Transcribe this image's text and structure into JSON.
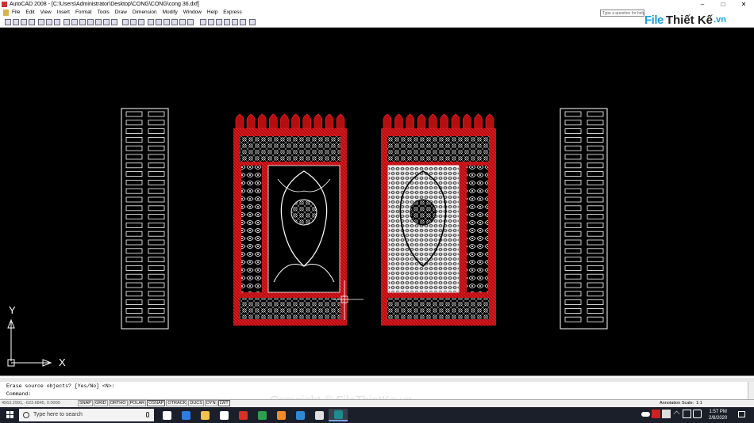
{
  "window": {
    "title": "AutoCAD 2008 - [C:\\Users\\Administrator\\Desktop\\CONG\\CONG\\cong 36.dxf]",
    "controls": [
      "–",
      "□",
      "✕"
    ]
  },
  "menu": {
    "items": [
      "File",
      "Edit",
      "View",
      "Insert",
      "Format",
      "Tools",
      "Draw",
      "Dimension",
      "Modify",
      "Window",
      "Help",
      "Express"
    ],
    "help_placeholder": "Type a question for help"
  },
  "watermark": {
    "brand_part1": "File",
    "brand_part2": "Thiết Kế",
    "brand_part3": ".vn",
    "copyright": "Copyright © FileThietKe.vn"
  },
  "drawing": {
    "ucs_x_label": "X",
    "ucs_y_label": "Y",
    "colors": {
      "background": "#000000",
      "frame_red": "#cc1111",
      "pattern_white": "#ffffff"
    }
  },
  "command": {
    "history_line": "Erase source objects? [Yes/No] <N>:",
    "prompt": "Command:"
  },
  "status": {
    "coords": "4563.2991, -623.6845, 0.0000",
    "toggles": [
      "SNAP",
      "GRID",
      "ORTHO",
      "POLAR",
      "OSNAP",
      "OTRACK",
      "DUCS",
      "DYN",
      "LWT"
    ],
    "toggles_on": [
      "OSNAP",
      "LWT"
    ],
    "annotation_scale_label": "Annotation Scale:",
    "annotation_scale_value": "1:1"
  },
  "taskbar": {
    "search_placeholder": "Type here to search",
    "time": "1:57 PM",
    "date": "2/8/2020",
    "apps": [
      {
        "name": "task-view-icon",
        "color": "#ffffff"
      },
      {
        "name": "edge-icon",
        "color": "#2f7de1"
      },
      {
        "name": "file-explorer-icon",
        "color": "#f2c14e"
      },
      {
        "name": "store-icon",
        "color": "#ffffff"
      },
      {
        "name": "chrome-icon",
        "color": "#d93025"
      },
      {
        "name": "app-green-icon",
        "color": "#2e9e4f"
      },
      {
        "name": "app-orange-icon",
        "color": "#f28c28"
      },
      {
        "name": "app-blue-icon",
        "color": "#2f8ad6"
      },
      {
        "name": "app-paint-icon",
        "color": "#e0e0e0"
      },
      {
        "name": "autocad-icon",
        "color": "#1c8c8c"
      }
    ]
  }
}
